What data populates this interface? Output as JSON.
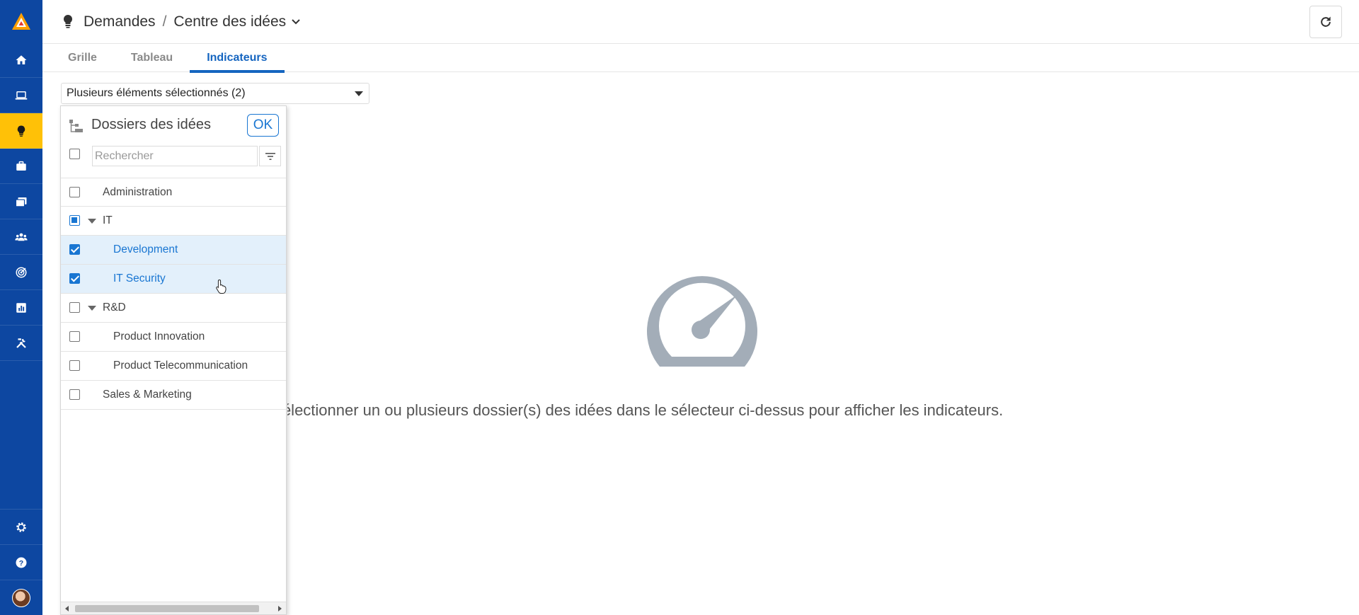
{
  "sidebar": {
    "items": [
      {
        "icon": "home-icon"
      },
      {
        "icon": "laptop-icon"
      },
      {
        "icon": "lightbulb-icon",
        "active": true
      },
      {
        "icon": "briefcase-icon"
      },
      {
        "icon": "folders-icon"
      },
      {
        "icon": "users-icon"
      },
      {
        "icon": "target-icon"
      },
      {
        "icon": "chart-icon"
      },
      {
        "icon": "tools-icon"
      }
    ],
    "bottom": [
      {
        "icon": "gear-icon"
      },
      {
        "icon": "help-icon"
      },
      {
        "icon": "avatar"
      }
    ],
    "colors": {
      "background": "#0d47a1",
      "active": "#ffc107"
    }
  },
  "header": {
    "breadcrumb_root": "Demandes",
    "separator": "/",
    "breadcrumb_current": "Centre des idées"
  },
  "tabs": [
    {
      "label": "Grille",
      "active": false
    },
    {
      "label": "Tableau",
      "active": false
    },
    {
      "label": "Indicateurs",
      "active": true
    }
  ],
  "selector": {
    "value": "Plusieurs éléments sélectionnés (2)"
  },
  "panel": {
    "title": "Dossiers des idées",
    "ok_label": "OK",
    "search_placeholder": "Rechercher",
    "rows": [
      {
        "label": "Administration",
        "state": "unchecked",
        "level": 0,
        "expandable": false
      },
      {
        "label": "IT",
        "state": "partial",
        "level": 0,
        "expandable": true
      },
      {
        "label": "Development",
        "state": "checked",
        "level": 1,
        "expandable": false
      },
      {
        "label": "IT Security",
        "state": "checked",
        "level": 1,
        "expandable": false
      },
      {
        "label": "R&D",
        "state": "unchecked",
        "level": 0,
        "expandable": true
      },
      {
        "label": "Product Innovation",
        "state": "unchecked",
        "level": 1,
        "expandable": false
      },
      {
        "label": "Product Telecommunication",
        "state": "unchecked",
        "level": 1,
        "expandable": false
      },
      {
        "label": "Sales & Marketing",
        "state": "unchecked",
        "level": 0,
        "expandable": false
      }
    ]
  },
  "empty_state": {
    "icon": "gauge-icon",
    "message": "Veuillez sélectionner un ou plusieurs dossier(s) des idées dans le sélecteur ci-dessus pour afficher les indicateurs."
  },
  "accent_color": "#1976d2"
}
